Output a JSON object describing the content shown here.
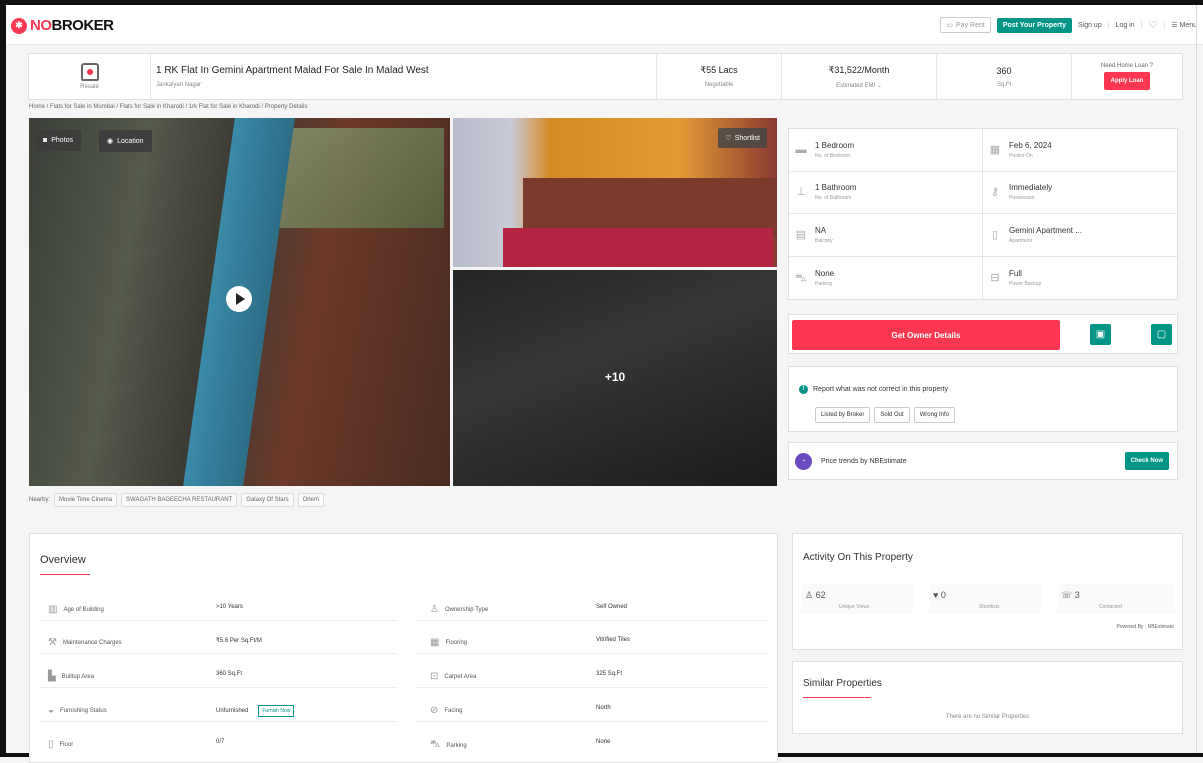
{
  "nav": {
    "logo_no": "NO",
    "logo_broker": "BROKER",
    "pay_rent": "Pay Rent",
    "post_property": "Post Your Property",
    "sign_up": "Sign up",
    "log_in": "Log in",
    "menu": "Menu"
  },
  "header": {
    "category": "Resale",
    "title": "1 RK Flat In Gemini Apartment Malad For Sale In Malad West",
    "locality": "Jankalyan Nagar",
    "price": "₹55 Lacs",
    "price_note": "Negotiable",
    "emi": "₹31,522/Month",
    "emi_note": "Estimated EMI ⌄",
    "area": "360",
    "area_unit": "Sq.Ft",
    "loan_question": "Need Home Loan ?",
    "apply_loan": "Apply Loan"
  },
  "breadcrumb": "Home / Flats for Sale in Mumbai / Flats for Sale in Kharodi / 1rk Flat for Sale in Kharodi / Property Details",
  "gallery": {
    "photos_label": "Photos",
    "location_label": "Location",
    "shortlist_label": "Shortlist",
    "more_count": "+10"
  },
  "nearby": {
    "label": "Nearby:",
    "places": [
      "Movie Time Cinema",
      "SWAGATH BAGEECHA RESTAURANT",
      "Galaxy Of Stars",
      "Orlem"
    ]
  },
  "details": [
    {
      "value": "1 Bedroom",
      "label": "No. of Bedroom",
      "icon": "bed-icon"
    },
    {
      "value": "Feb 6, 2024",
      "label": "Posted On",
      "icon": "calendar-icon"
    },
    {
      "value": "1 Bathroom",
      "label": "No. of Bathroom",
      "icon": "bath-icon"
    },
    {
      "value": "Immediately",
      "label": "Possession",
      "icon": "key-icon"
    },
    {
      "value": "NA",
      "label": "Balcony",
      "icon": "balcony-icon"
    },
    {
      "value": "Gemini Apartment ...",
      "label": "Apartment",
      "icon": "building-icon"
    },
    {
      "value": "None",
      "label": "Parking",
      "icon": "car-icon"
    },
    {
      "value": "Full",
      "label": "Power Backup",
      "icon": "power-icon"
    }
  ],
  "owner": {
    "button": "Get Owner Details"
  },
  "report": {
    "title": "Report what was not correct in this property",
    "options": [
      "Listed by Broker",
      "Sold Out",
      "Wrong Info"
    ]
  },
  "trend": {
    "text": "Price trends by NBEstimate",
    "button": "Check Now"
  },
  "overview": {
    "title": "Overview",
    "rows": [
      {
        "l1": "Age of Building",
        "v1": ">10 Years",
        "l2": "Ownership Type",
        "v2": "Self Owned"
      },
      {
        "l1": "Maintenance Charges",
        "v1": "₹5.6 Per Sq.Ft/M",
        "l2": "Flooring",
        "v2": "Vitrified Tiles"
      },
      {
        "l1": "Builtup Area",
        "v1": "360 Sq.Ft",
        "l2": "Carpet Area",
        "v2": "325 Sq.Ft"
      },
      {
        "l1": "Furnishing Status",
        "v1": "Unfurnished",
        "l2": "Facing",
        "v2": "North"
      },
      {
        "l1": "Floor",
        "v1": "0/7",
        "l2": "Parking",
        "v2": "None"
      }
    ],
    "furnish_now": "Furnish Now"
  },
  "activity": {
    "title": "Activity On This Property",
    "views": "62",
    "views_label": "Unique Views",
    "shortlists": "0",
    "shortlists_label": "Shortlists",
    "contacted": "3",
    "contacted_label": "Contacted",
    "powered": "Powered By : NBEstimate"
  },
  "similar": {
    "title": "Similar Properties",
    "empty": "There are no Similar Properties"
  }
}
